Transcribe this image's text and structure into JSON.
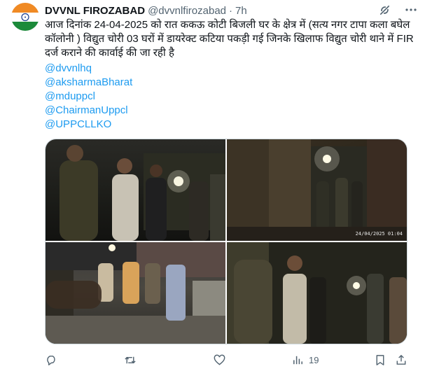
{
  "post": {
    "display_name": "DVVNL FIROZABAD",
    "handle": "@dvvnlfirozabad",
    "separator": "·",
    "time": "7h",
    "text": "आज दिनांक 24-04-2025 को रात ककऊ कोटी बिजली घर के क्षेत्र में (सत्य नगर टापा कला बघेल कॉलोनी ) विद्युत चोरी 03 घरों में डायरेक्ट कटिया पकड़ी गई जिनके खिलाफ विद्युत चोरी थाने में FIR दर्ज कराने की कार्वाई की जा रही है",
    "mentions": [
      "@dvvnlhq",
      "@aksharmaBharat",
      "@mduppcl",
      "@ChairmanUppcl",
      "@UPPCLLKO"
    ]
  },
  "media": {
    "photo_timestamp": "24/04/2025 01:04"
  },
  "actions": {
    "reply_count": "",
    "repost_count": "",
    "like_count": "",
    "views_count": "19"
  },
  "icons": {
    "avatar": "india-flag-avatar",
    "grok": "grok-icon",
    "more": "more-icon",
    "reply": "reply-icon",
    "repost": "repost-icon",
    "like": "like-icon",
    "views": "views-icon",
    "bookmark": "bookmark-icon",
    "share": "share-icon"
  },
  "colors": {
    "text": "#0f1419",
    "secondary": "#536471",
    "link": "#1d9bf0",
    "border": "#cfd9de"
  }
}
